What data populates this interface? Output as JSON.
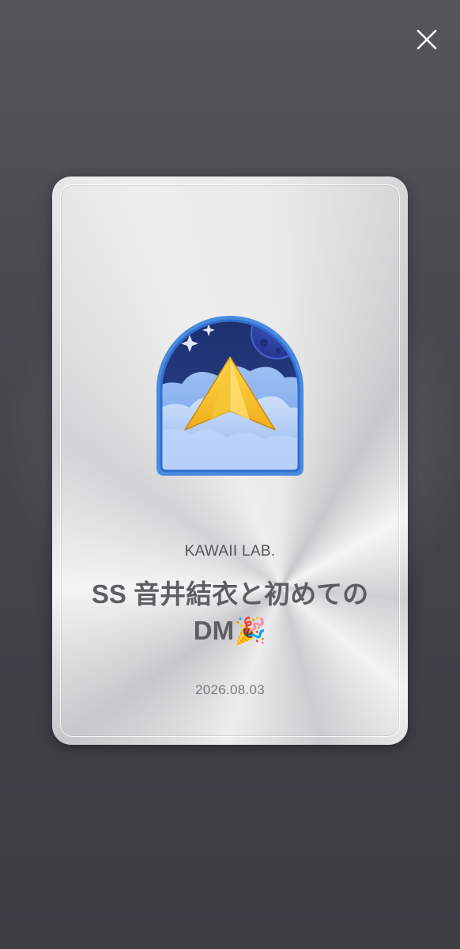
{
  "dialog": {
    "close_icon": "close-icon"
  },
  "card": {
    "badge_icon": "paper-plane-night-sky-badge-icon",
    "org_name": "KAWAII LAB.",
    "title": "SS 音井結衣と初めてのDM🎉",
    "date": "2026.08.03"
  }
}
